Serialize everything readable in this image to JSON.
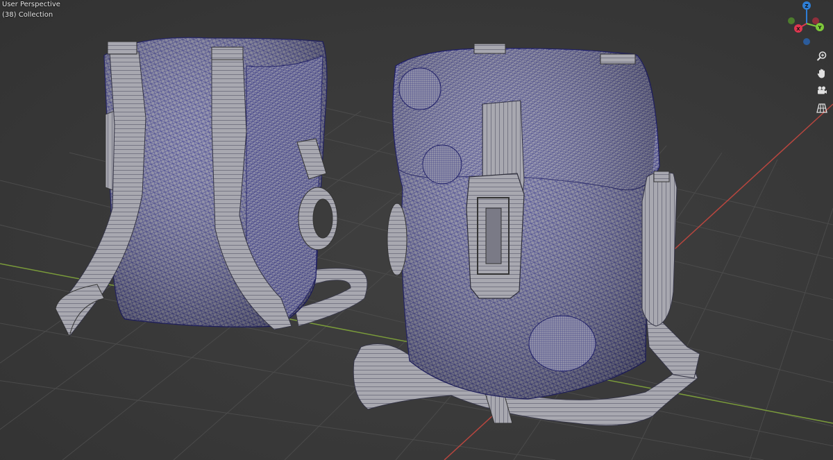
{
  "viewport": {
    "perspective_label": "User Perspective",
    "collection_label": "(38) Collection",
    "background_color": "#3a3a3a",
    "grid_color": "#4a4a4a",
    "x_axis_color": "#c0443f",
    "y_axis_color": "#7ba13a",
    "wire_color": "#2a2a8a",
    "mesh_fill_color": "#8c8ca8",
    "strap_color": "#a5a5ad"
  },
  "gizmo": {
    "z_label": "Z",
    "x_label": "X",
    "y_label": "Y",
    "z_color": "#2e7ed6",
    "x_color": "#e0364f",
    "y_color": "#7ec83a",
    "neg_x_color": "#8f2f3c",
    "neg_y_color": "#4d7c2d",
    "neg_z_color": "#2b5b9a"
  },
  "nav_tools": [
    {
      "name": "zoom-icon"
    },
    {
      "name": "hand-icon"
    },
    {
      "name": "camera-icon"
    },
    {
      "name": "grid-icon"
    }
  ]
}
